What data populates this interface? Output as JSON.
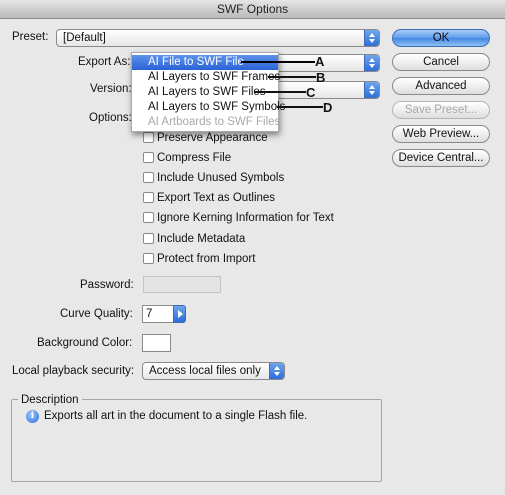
{
  "window": {
    "title": "SWF Options"
  },
  "preset": {
    "label": "Preset:",
    "value": "[Default]"
  },
  "export_as": {
    "label": "Export As:"
  },
  "version": {
    "label": "Version:"
  },
  "options": {
    "label": "Options:"
  },
  "menu": {
    "items": [
      {
        "label": "AI File to SWF File",
        "selected": true,
        "enabled": true,
        "callout": "A"
      },
      {
        "label": "AI Layers to SWF Frames",
        "selected": false,
        "enabled": true,
        "callout": "B"
      },
      {
        "label": "AI Layers to SWF Files",
        "selected": false,
        "enabled": true,
        "callout": "C"
      },
      {
        "label": "AI Layers to SWF Symbols",
        "selected": false,
        "enabled": true,
        "callout": "D"
      },
      {
        "label": "AI Artboards to SWF Files",
        "selected": false,
        "enabled": false
      }
    ]
  },
  "checkboxes": [
    {
      "label": "Preserve Appearance",
      "checked": false
    },
    {
      "label": "Compress File",
      "checked": false
    },
    {
      "label": "Include Unused Symbols",
      "checked": false
    },
    {
      "label": "Export Text as Outlines",
      "checked": false
    },
    {
      "label": "Ignore Kerning Information for Text",
      "checked": false
    },
    {
      "label": "Include Metadata",
      "checked": false
    },
    {
      "label": "Protect from Import",
      "checked": false
    }
  ],
  "password": {
    "label": "Password:",
    "value": ""
  },
  "curve_quality": {
    "label": "Curve Quality:",
    "value": "7"
  },
  "background_color": {
    "label": "Background Color:",
    "color": "#ffffff"
  },
  "local_playback": {
    "label": "Local playback security:",
    "value": "Access local files only"
  },
  "description": {
    "title": "Description",
    "text": "Exports all art in the document to a single Flash file."
  },
  "buttons": {
    "ok": "OK",
    "cancel": "Cancel",
    "advanced": "Advanced",
    "save_preset": "Save Preset...",
    "web_preview": "Web Preview...",
    "device_central": "Device Central..."
  },
  "icons": {
    "popup_arrows": "updown-arrows-icon",
    "info": "info-icon"
  }
}
